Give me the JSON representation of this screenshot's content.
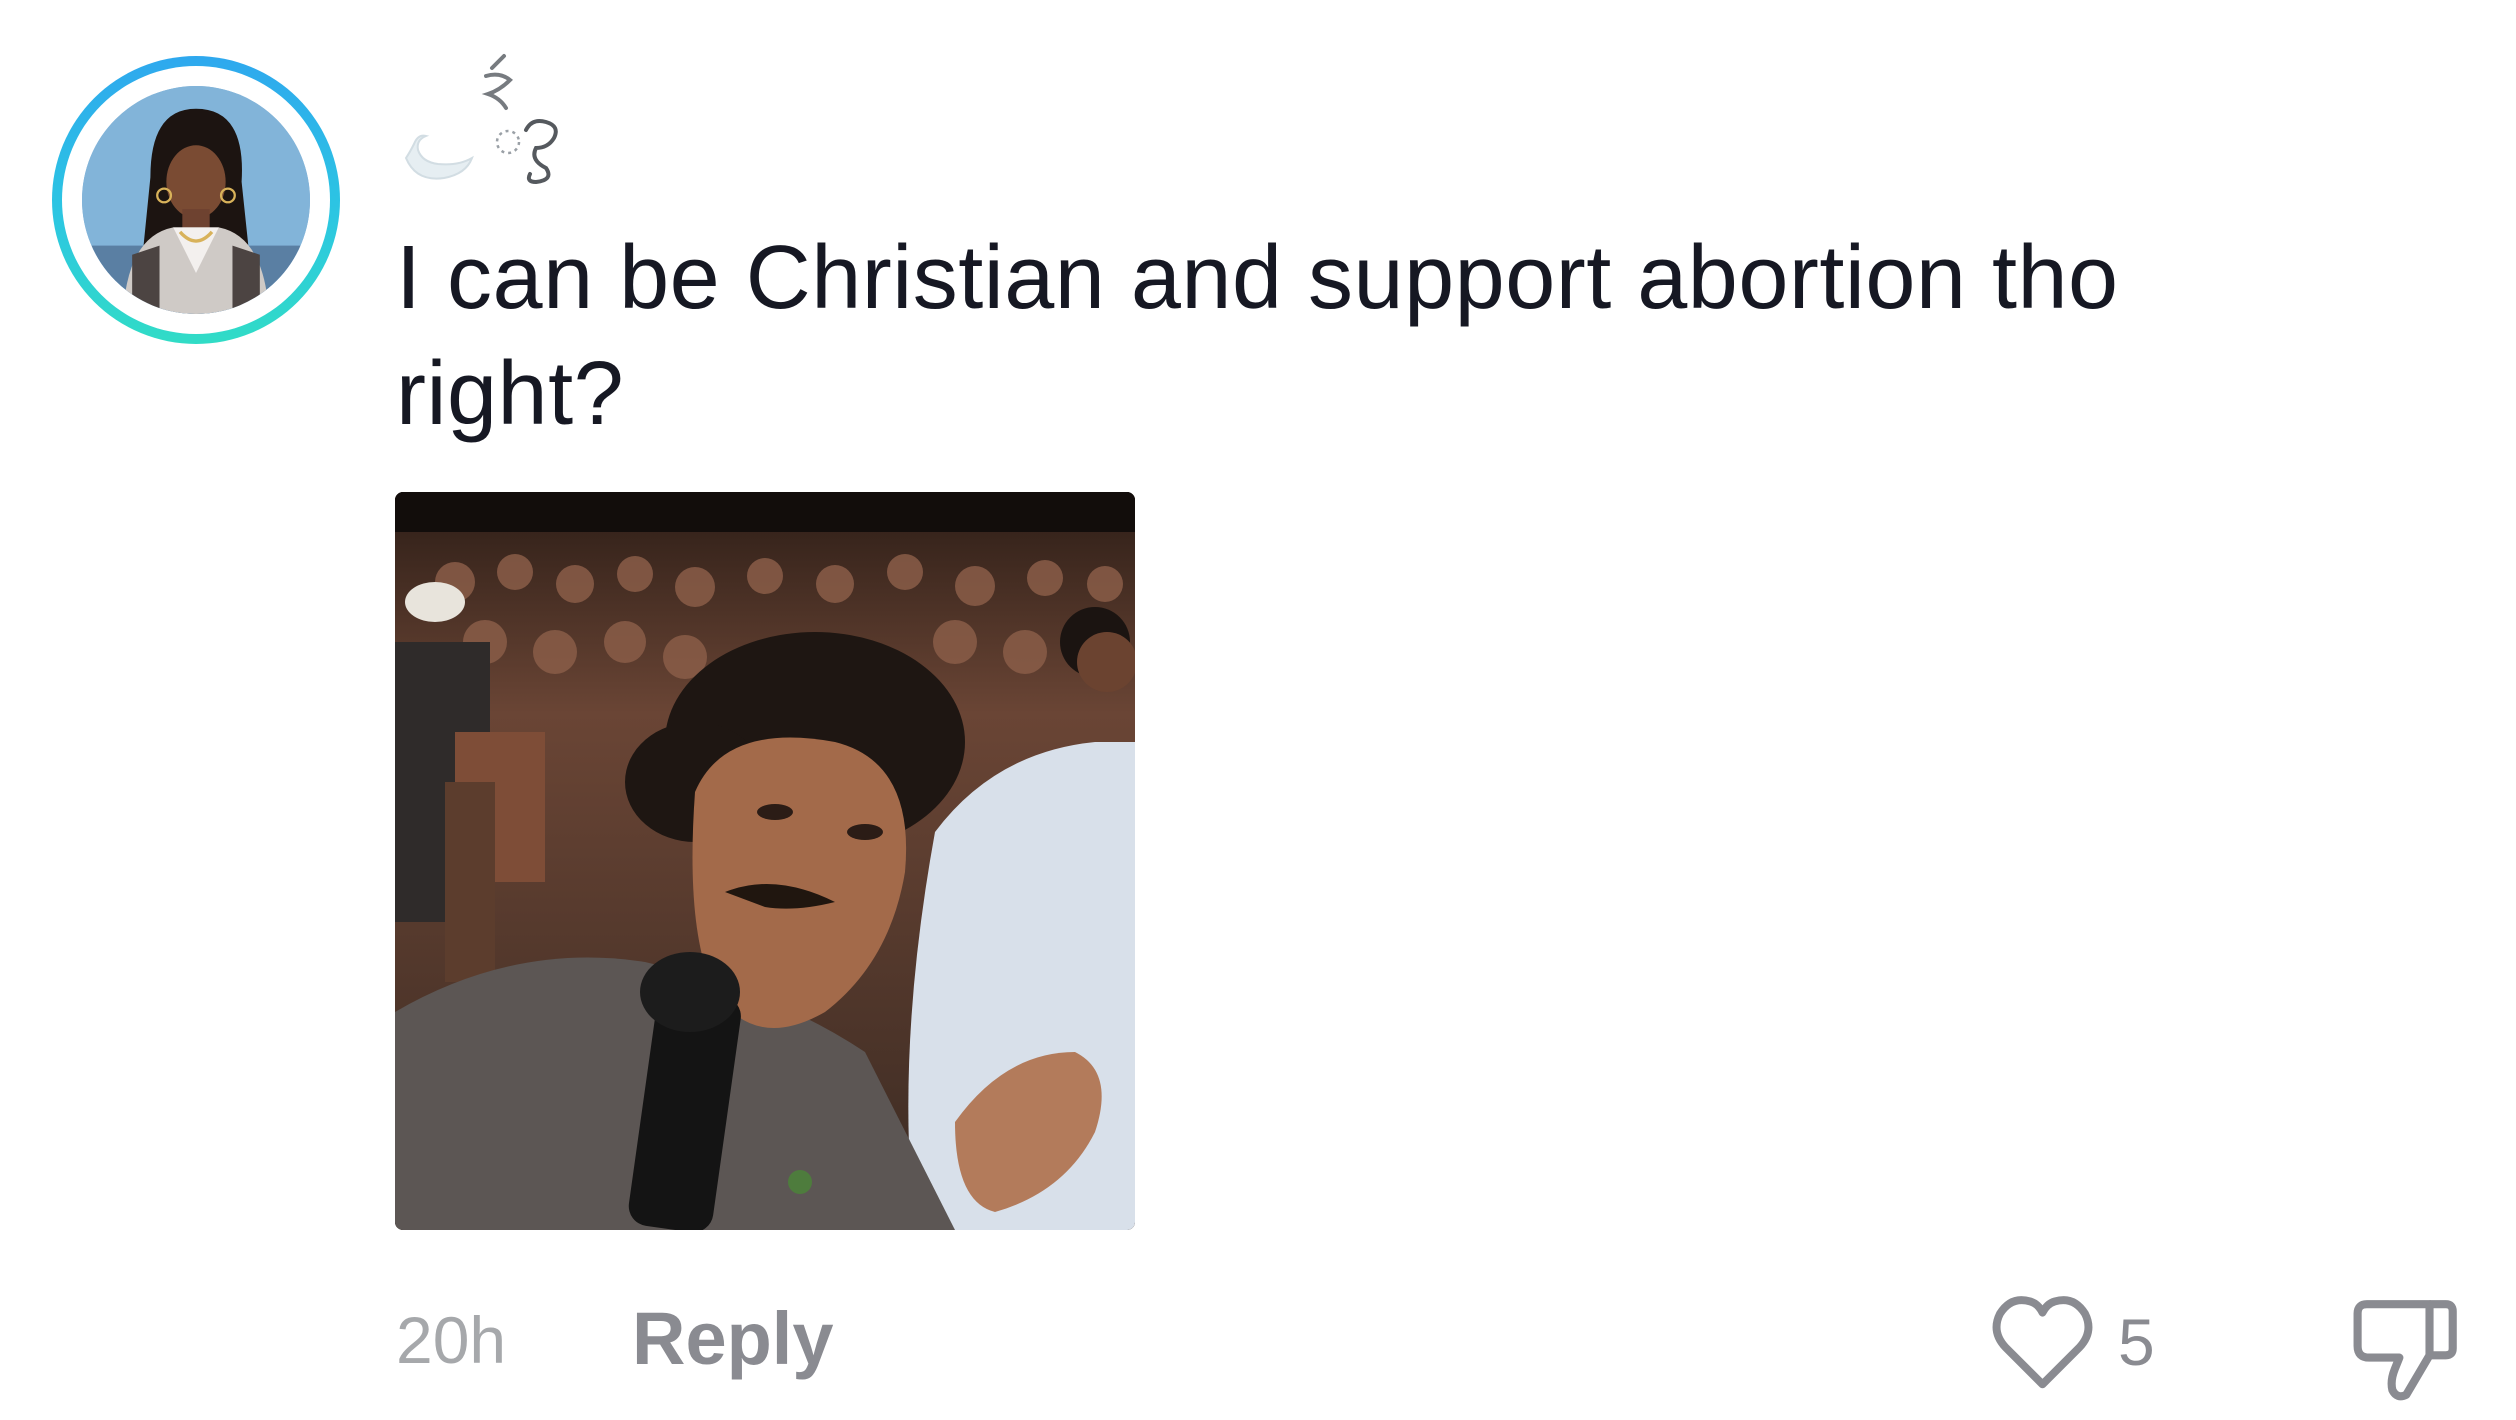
{
  "comment": {
    "text": "I can be Christian and support abortion tho right?",
    "time": "20h",
    "reply_label": "Reply",
    "like_count": "5"
  },
  "colors": {
    "text_primary": "#161823",
    "text_secondary": "#8a8b91",
    "ring_start": "#2ea8ee",
    "ring_end": "#31dcc6",
    "background": "#ffffff"
  },
  "icons": {
    "like": "heart-outline-icon",
    "dislike": "thumbs-down-icon"
  }
}
